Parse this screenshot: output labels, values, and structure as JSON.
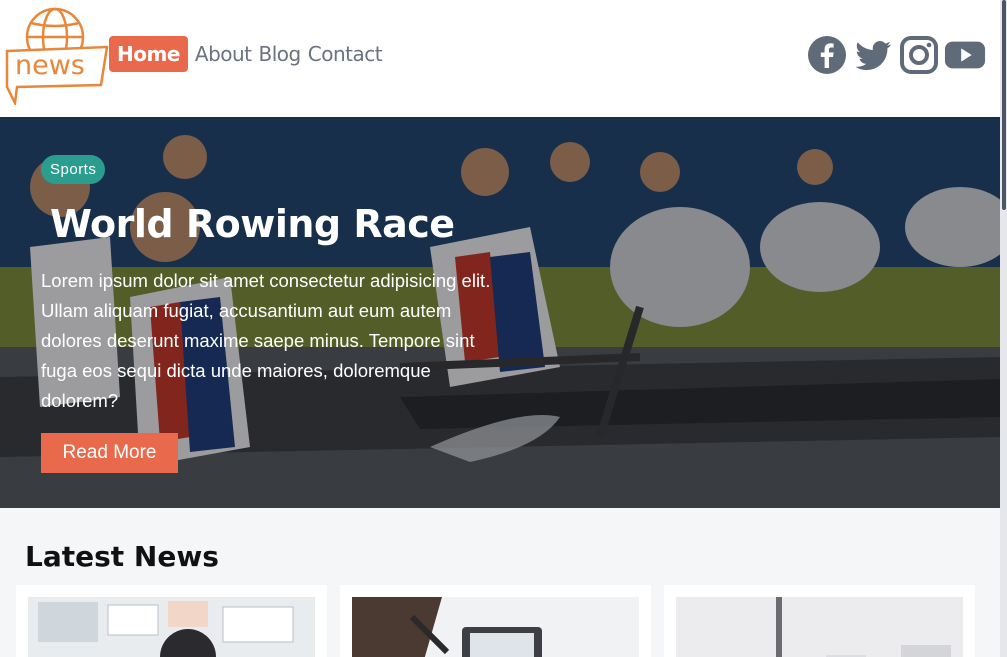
{
  "header": {
    "logo_text": "news",
    "nav": [
      {
        "label": "Home",
        "active": true
      },
      {
        "label": "About",
        "active": false
      },
      {
        "label": "Blog",
        "active": false
      },
      {
        "label": "Contact",
        "active": false
      }
    ],
    "social": [
      "facebook-icon",
      "twitter-icon",
      "instagram-icon",
      "youtube-icon"
    ]
  },
  "hero": {
    "category": "Sports",
    "title": "World Rowing Race",
    "text": "Lorem ipsum dolor sit amet consectetur adipisicing elit. Ullam aliquam fugiat, accusantium aut eum autem dolores deserunt maxime saepe minus. Tempore sint fuga eos sequi dicta unde maiores, doloremque dolorem?",
    "button": "Read More"
  },
  "latest": {
    "title": "Latest News",
    "cards": [
      {
        "image": "office-whiteboard"
      },
      {
        "image": "laptop-work"
      },
      {
        "image": "building-exterior"
      }
    ]
  },
  "colors": {
    "accent": "#e8694c",
    "badge": "#2a9d8f",
    "nav_text": "#6b7280"
  }
}
